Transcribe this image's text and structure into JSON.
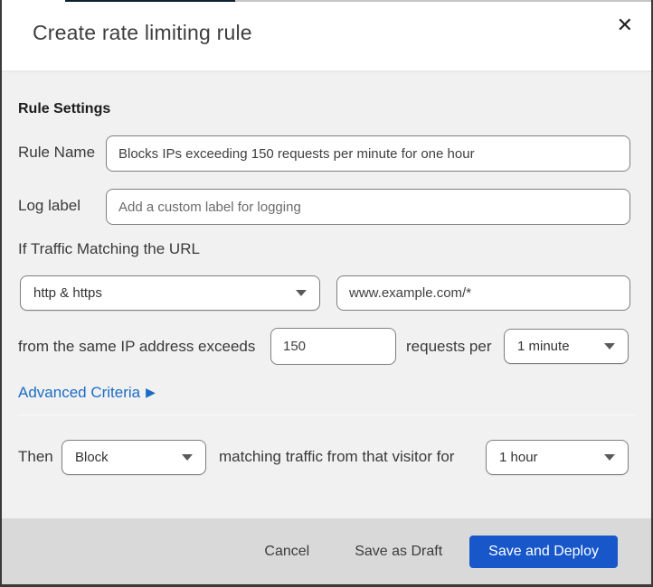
{
  "dialog": {
    "title": "Create rate limiting rule",
    "close_icon": "✕"
  },
  "rule_settings": {
    "heading": "Rule Settings",
    "rule_name": {
      "label": "Rule Name",
      "value": "Blocks IPs exceeding 150 requests per minute for one hour"
    },
    "log_label": {
      "label": "Log label",
      "placeholder": "Add a custom label for logging"
    }
  },
  "traffic_match": {
    "heading": "If Traffic Matching the URL",
    "scheme_select": {
      "value": "http & https"
    },
    "url_input": {
      "value": "www.example.com/*"
    },
    "threshold_prefix": "from the same IP address exceeds",
    "requests_input": {
      "value": "150"
    },
    "threshold_middle": "requests per",
    "period_select": {
      "value": "1 minute"
    },
    "advanced_link": {
      "label": "Advanced Criteria",
      "arrow": "▶"
    }
  },
  "action": {
    "then_label": "Then",
    "action_select": {
      "value": "Block"
    },
    "sentence": "matching traffic from that visitor for",
    "duration_select": {
      "value": "1 hour"
    }
  },
  "footer": {
    "cancel_label": "Cancel",
    "save_draft_label": "Save as Draft",
    "save_deploy_label": "Save and Deploy"
  },
  "colors": {
    "accent_blue": "#1b6cc4",
    "primary_button_blue": "#1757c9",
    "footer_grey": "#d9d9d9",
    "content_grey": "#f1f1f2"
  }
}
